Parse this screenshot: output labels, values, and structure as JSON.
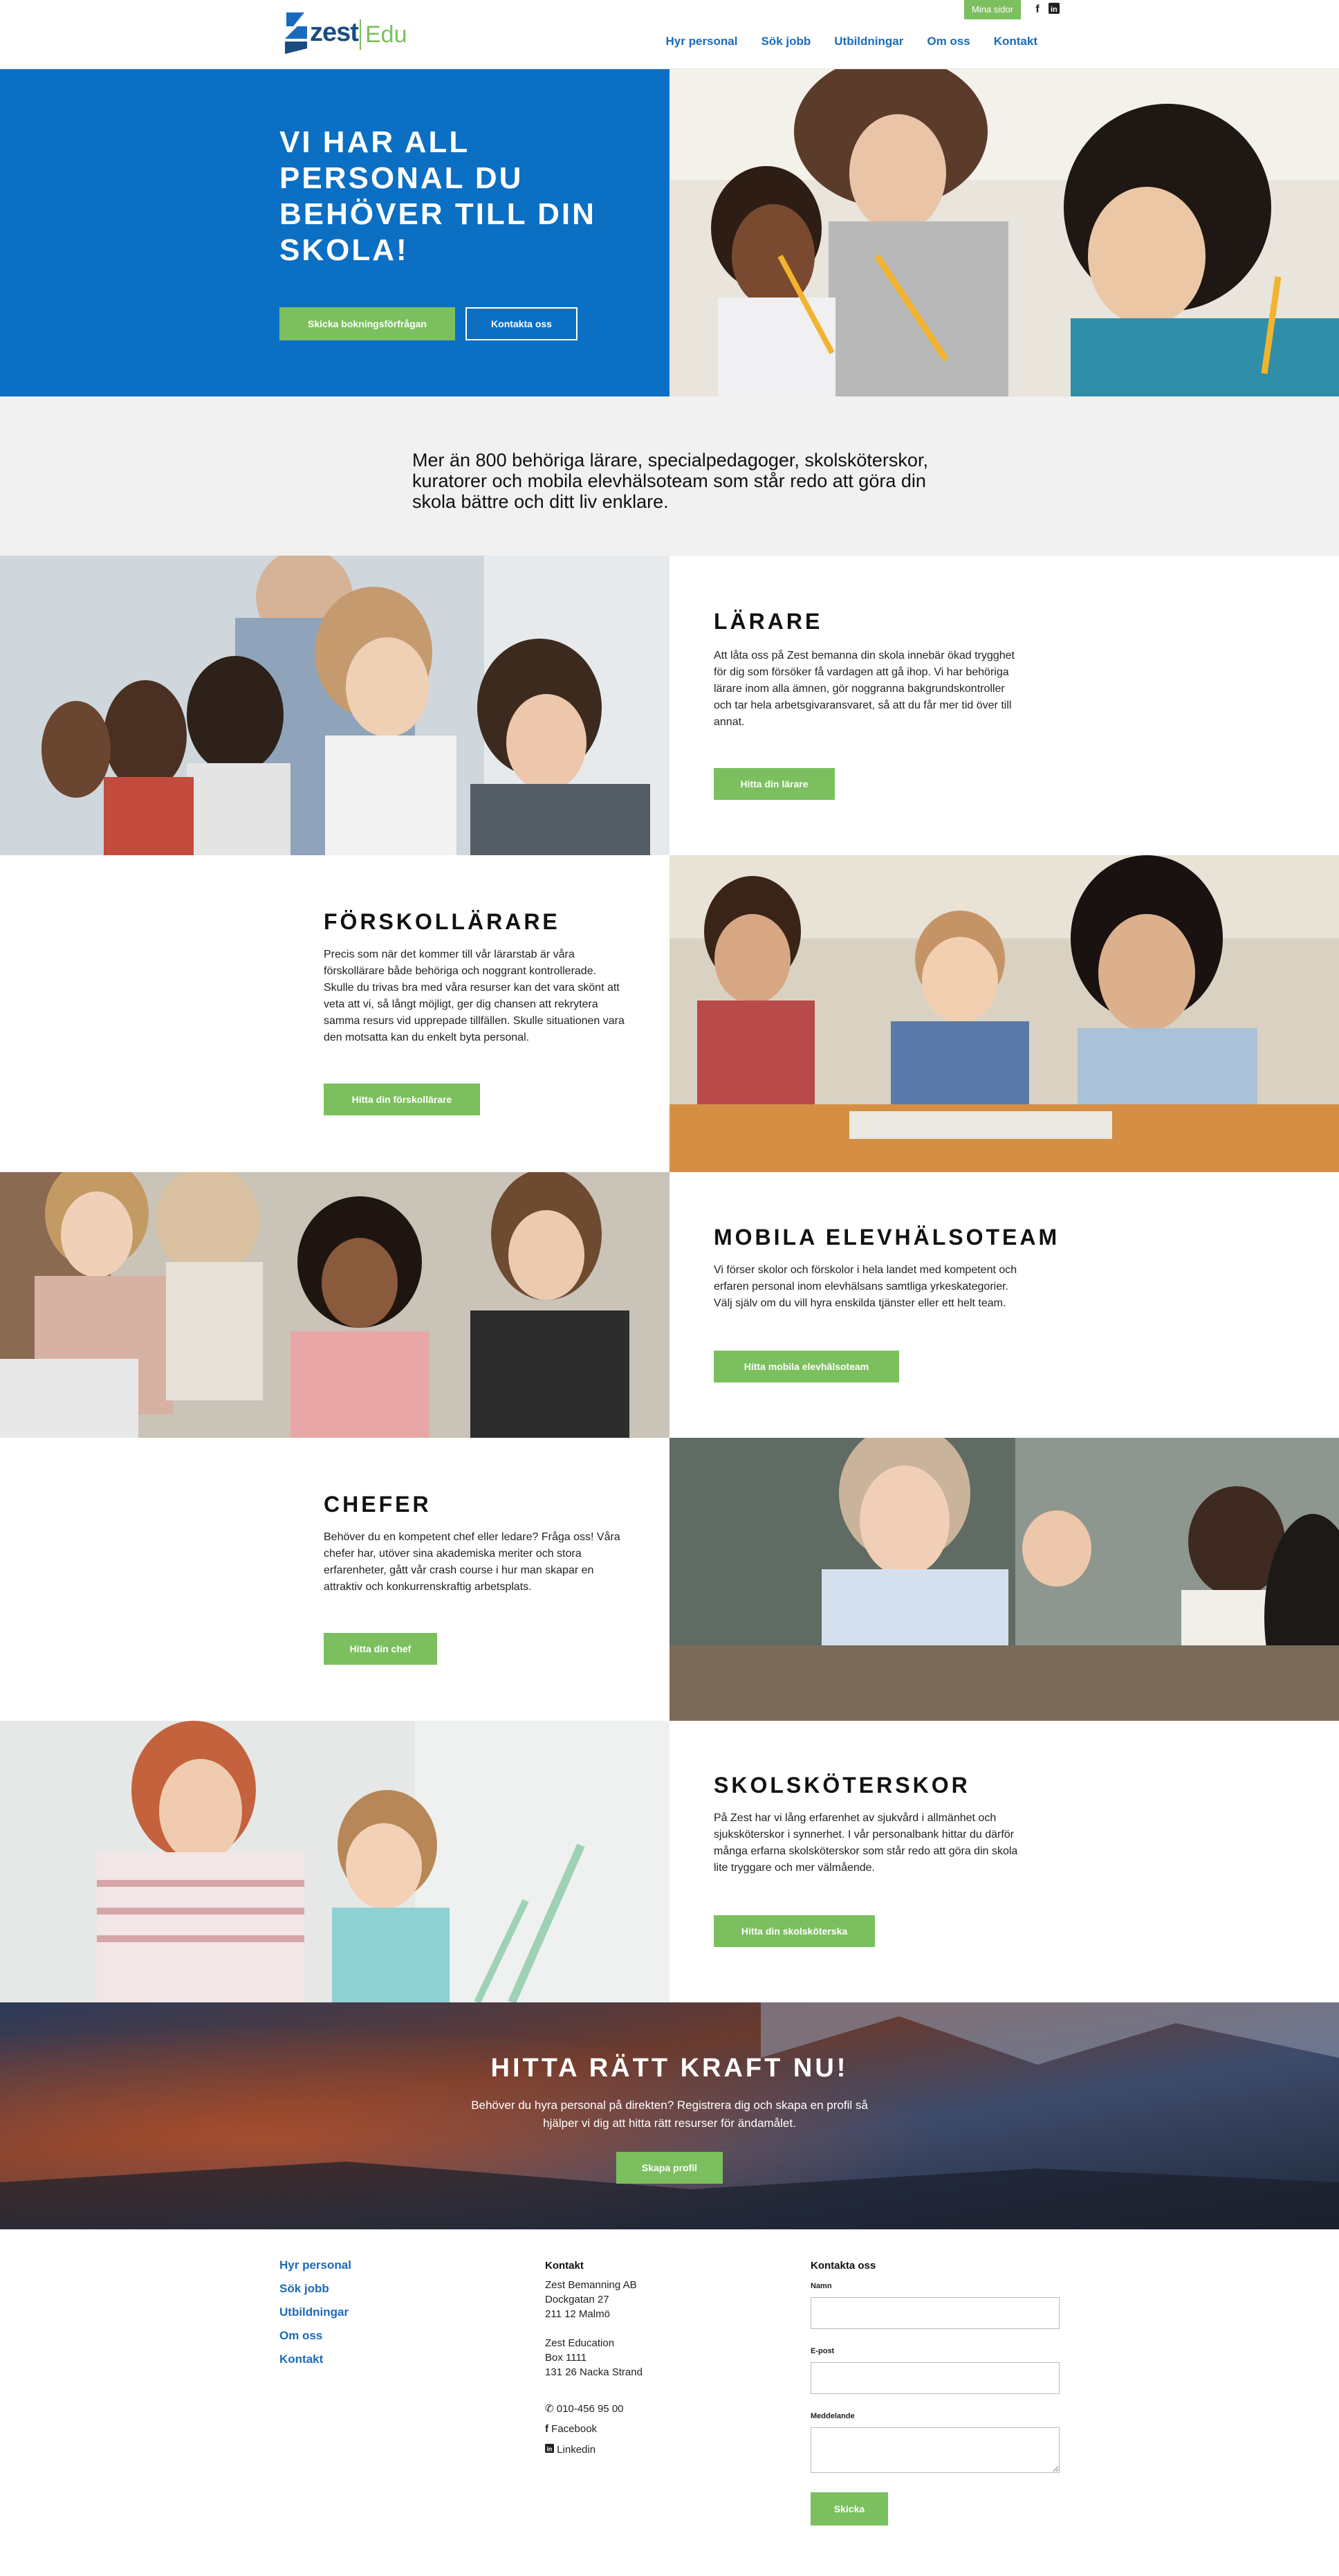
{
  "header": {
    "logo_brand": "zest",
    "logo_sub": "Edu",
    "mina_sidor": "Mina sidor",
    "nav": [
      "Hyr personal",
      "Sök jobb",
      "Utbildningar",
      "Om oss",
      "Kontakt"
    ]
  },
  "hero": {
    "title": "VI HAR ALL PERSONAL DU BEHÖVER TILL DIN SKOLA!",
    "primary_button": "Skicka bokningsförfrågan",
    "secondary_button": "Kontakta oss"
  },
  "intro": {
    "text": "Mer än 800 behöriga lärare, specialpedagoger, skolsköterskor, kuratorer och mobila elevhälsoteam som står redo att göra din skola bättre och ditt liv enklare."
  },
  "sections": [
    {
      "title": "LÄRARE",
      "body": "Att låta oss på Zest bemanna din skola innebär ökad trygghet för dig som försöker få vardagen att gå ihop. Vi har behöriga lärare inom alla ämnen, gör noggranna bakgrundskontroller och tar hela arbetsgivaransvaret, så att du får mer tid över till annat.",
      "button": "Hitta din lärare"
    },
    {
      "title": "FÖRSKOLLÄRARE",
      "body": "Precis som när det kommer till vår lärarstab är våra förskollärare både behöriga och noggrant kontrollerade. Skulle du trivas bra med våra resurser kan det vara skönt att veta att vi, så långt möjligt, ger dig chansen att rekrytera samma resurs vid upprepade tillfällen. Skulle situationen vara den motsatta kan du enkelt byta personal.",
      "button": "Hitta din förskollärare"
    },
    {
      "title": "MOBILA ELEVHÄLSOTEAM",
      "body": "Vi förser skolor och förskolor i hela landet med kompetent och erfaren personal inom elevhälsans samtliga yrkeskategorier. Välj själv om du vill hyra enskilda tjänster eller ett helt team.",
      "button": "Hitta mobila elevhälsoteam"
    },
    {
      "title": "CHEFER",
      "body": "Behöver du en kompetent chef eller ledare? Fråga oss! Våra chefer har, utöver sina akademiska meriter och stora erfarenheter, gått vår crash course i hur man skapar en attraktiv och konkurrenskraftig arbetsplats.",
      "button": "Hitta din chef"
    },
    {
      "title": "SKOLSKÖTERSKOR",
      "body": "På Zest har vi lång erfarenhet av sjukvård i allmänhet och sjuksköterskor i synnerhet. I vår personalbank hittar du därför många erfarna skolsköterskor som står redo att göra din skola lite tryggare och mer välmående.",
      "button": "Hitta din skolsköterska"
    }
  ],
  "cta": {
    "title": "HITTA RÄTT KRAFT NU!",
    "text": "Behöver du hyra personal på direkten? Registrera dig och skapa en profil så hjälper vi dig att hitta rätt resurser för ändamålet.",
    "button": "Skapa profil"
  },
  "footer": {
    "links": [
      "Hyr personal",
      "Sök jobb",
      "Utbildningar",
      "Om oss",
      "Kontakt"
    ],
    "contact_heading": "Kontakt",
    "address1": [
      "Zest Bemanning AB",
      "Dockgatan 27",
      "211 12 Malmö"
    ],
    "address2": [
      "Zest Education",
      "Box 1111",
      "131 26 Nacka Strand"
    ],
    "phone": "010-456 95 00",
    "facebook": "Facebook",
    "linkedin": "Linkedin",
    "form_heading": "Kontakta oss",
    "label_name": "Namn",
    "label_email": "E-post",
    "label_message": "Meddelande",
    "submit": "Skicka"
  },
  "colors": {
    "brand_blue": "#0b6fc3",
    "link_blue": "#1a6bbd",
    "accent_green": "#7cbf5e"
  }
}
